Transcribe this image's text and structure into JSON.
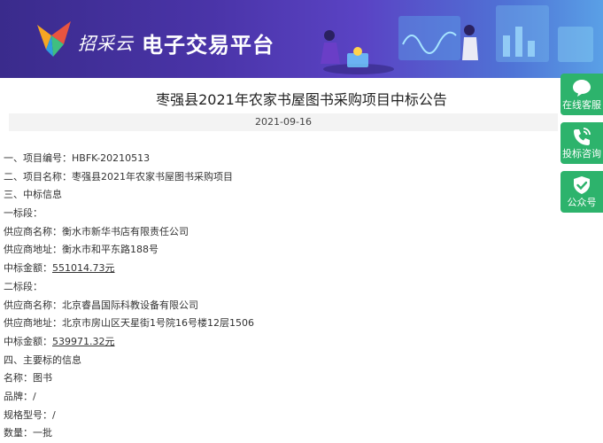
{
  "banner": {
    "brand": "招采云",
    "platform": "电子交易平台"
  },
  "notice": {
    "title": "枣强县2021年农家书屋图书采购项目中标公告",
    "date": "2021-09-16"
  },
  "content": [
    {
      "label": "一、项目编号：",
      "value": "HBFK-20210513"
    },
    {
      "label": "二、项目名称：",
      "value": "枣强县2021年农家书屋图书采购项目"
    },
    {
      "label": "三、中标信息",
      "value": ""
    },
    {
      "label": "一标段：",
      "value": ""
    },
    {
      "label": "供应商名称：",
      "value": "衡水市新华书店有限责任公司"
    },
    {
      "label": "供应商地址：",
      "value": "衡水市和平东路188号"
    },
    {
      "label": "中标金额：",
      "value": "551014.73元"
    },
    {
      "label": "二标段：",
      "value": ""
    },
    {
      "label": "供应商名称：",
      "value": "北京睿昌国际科教设备有限公司"
    },
    {
      "label": "供应商地址：",
      "value": "北京市房山区天星街1号院16号楼12层1506"
    },
    {
      "label": "中标金额：",
      "value": "539971.32元"
    },
    {
      "label": "四、主要标的信息",
      "value": ""
    },
    {
      "label": "名称：",
      "value": "图书"
    },
    {
      "label": "品牌：",
      "value": "/"
    },
    {
      "label": "规格型号：",
      "value": "/"
    },
    {
      "label": "数量：",
      "value": "一批"
    }
  ],
  "side": {
    "service": "在线客服",
    "consult": "投标咨询",
    "wechat": "公众号"
  },
  "colors": {
    "side_green": "#2db36c",
    "banner_purple": "#4a34a8"
  }
}
